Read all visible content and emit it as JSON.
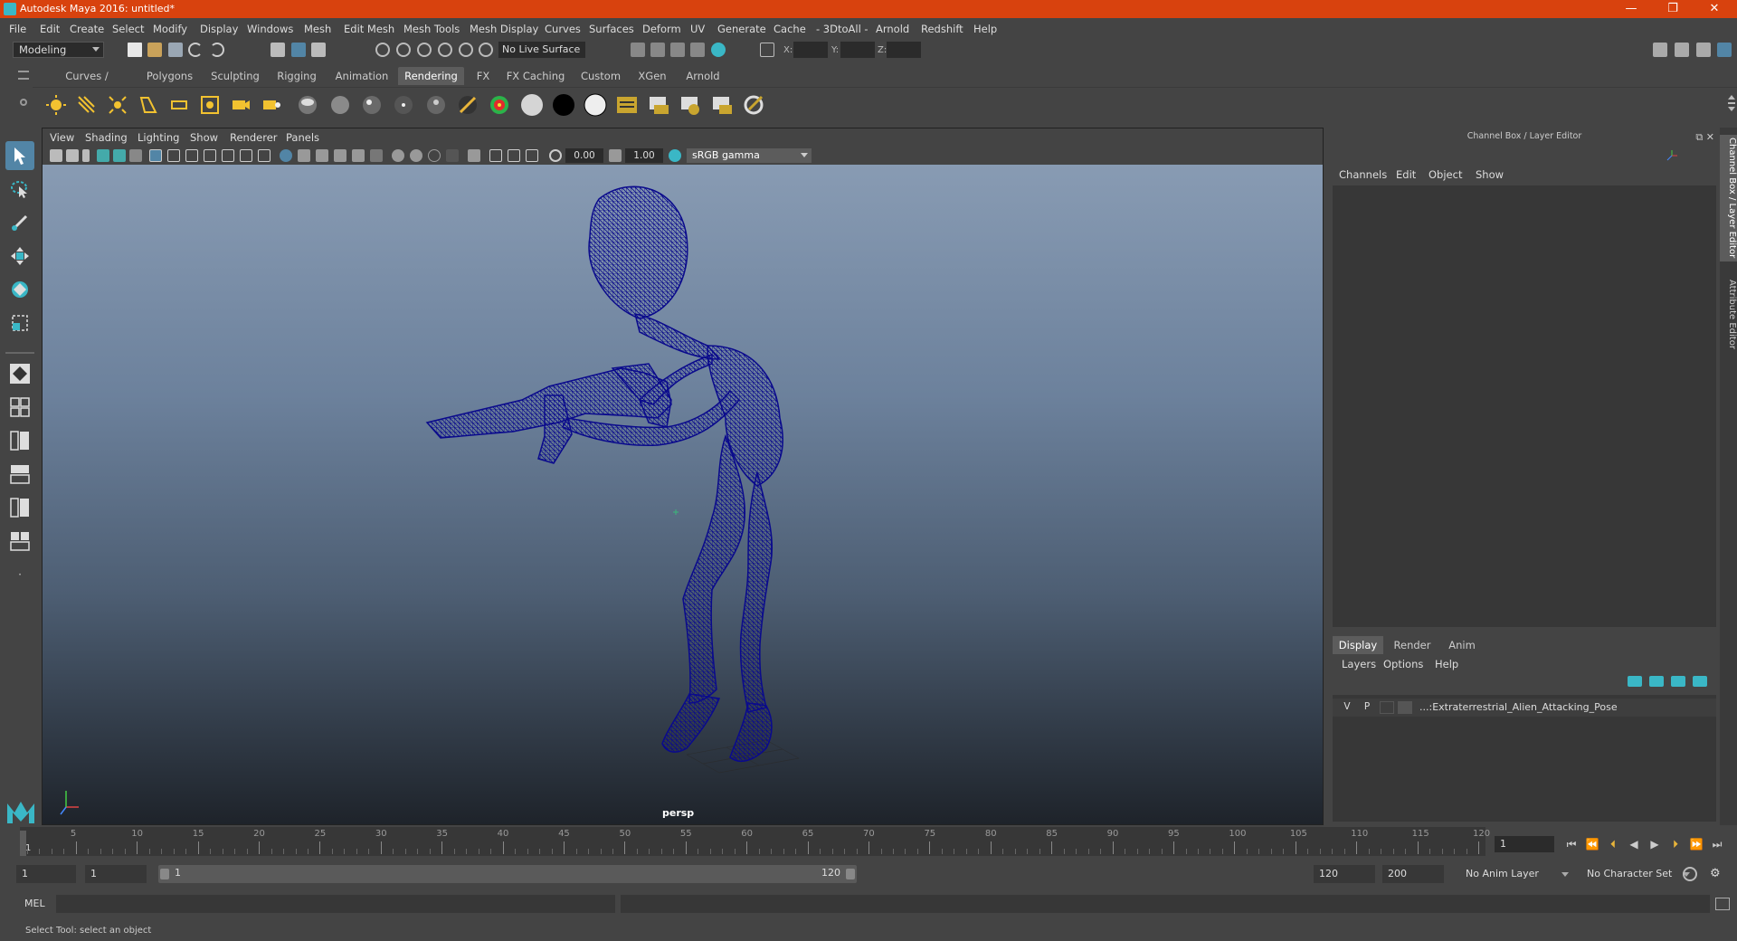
{
  "window": {
    "title": "Autodesk Maya 2016: untitled*",
    "minimize_glyph": "—",
    "restore_glyph": "❐",
    "close_glyph": "✕"
  },
  "menubar": {
    "items": [
      "File",
      "Edit",
      "Create",
      "Select",
      "Modify",
      "Display",
      "Windows",
      "Mesh",
      "Edit Mesh",
      "Mesh Tools",
      "Mesh Display",
      "Curves",
      "Surfaces",
      "Deform",
      "UV",
      "Generate",
      "Cache",
      "- 3DtoAll -",
      "Arnold",
      "Redshift",
      "Help"
    ]
  },
  "statusline": {
    "mode": "Modeling",
    "live_surface": "No Live Surface",
    "x_label": "X:",
    "y_label": "Y:",
    "z_label": "Z:"
  },
  "shelf": {
    "tabs": [
      "Curves / Surfaces",
      "Polygons",
      "Sculpting",
      "Rigging",
      "Animation",
      "Rendering",
      "FX",
      "FX Caching",
      "Custom",
      "XGen",
      "Arnold"
    ],
    "active_tab": "Rendering"
  },
  "viewport": {
    "menu": [
      "View",
      "Shading",
      "Lighting",
      "Show",
      "Renderer",
      "Panels"
    ],
    "exposure": "0.00",
    "gamma": "1.00",
    "color_space": "sRGB gamma",
    "camera": "persp"
  },
  "channel_box": {
    "title": "Channel Box / Layer Editor",
    "menu": [
      "Channels",
      "Edit",
      "Object",
      "Show"
    ]
  },
  "layer_editor": {
    "tabs": [
      "Display",
      "Render",
      "Anim"
    ],
    "active_tab": "Display",
    "menu": [
      "Layers",
      "Options",
      "Help"
    ],
    "layers": [
      {
        "v": "V",
        "p": "P",
        "name": "...:Extraterrestrial_Alien_Attacking_Pose"
      }
    ]
  },
  "side_tabs": [
    "Channel Box / Layer Editor",
    "Attribute Editor"
  ],
  "timeline": {
    "tick_labels": [
      "5",
      "10",
      "15",
      "20",
      "25",
      "30",
      "35",
      "40",
      "45",
      "50",
      "55",
      "60",
      "65",
      "70",
      "75",
      "80",
      "85",
      "90",
      "95",
      "100",
      "105",
      "110",
      "115",
      "120"
    ],
    "current_frame_label": "1",
    "current_frame_field": "1"
  },
  "range": {
    "start": "1",
    "playback_start": "1",
    "slider_min": "1",
    "slider_max": "120",
    "playback_end": "120",
    "end": "200",
    "anim_layer": "No Anim Layer",
    "character_set": "No Character Set"
  },
  "command_line": {
    "label": "MEL"
  },
  "help_line": {
    "text": "Select Tool: select an object"
  },
  "colors": {
    "title_bar": "#d8420e",
    "accent": "#5285a6",
    "wireframe": "#0a0a8c"
  }
}
